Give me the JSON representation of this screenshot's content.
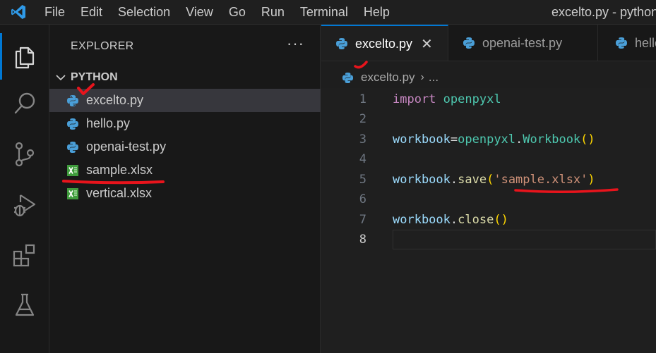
{
  "titlebar": {
    "menu": [
      "File",
      "Edit",
      "Selection",
      "View",
      "Go",
      "Run",
      "Terminal",
      "Help"
    ],
    "window_title": "excelto.py - python"
  },
  "activity_bar": {
    "icons": [
      "explorer-icon",
      "search-icon",
      "source-control-icon",
      "run-debug-icon",
      "extensions-icon",
      "testing-icon"
    ],
    "active": "explorer-icon",
    "accent": "#0078d4"
  },
  "sidebar": {
    "title": "EXPLORER",
    "more": "···",
    "folder": "PYTHON",
    "files": [
      {
        "name": "excelto.py",
        "icon": "python-file-icon",
        "selected": true
      },
      {
        "name": "hello.py",
        "icon": "python-file-icon",
        "selected": false
      },
      {
        "name": "openai-test.py",
        "icon": "python-file-icon",
        "selected": false
      },
      {
        "name": "sample.xlsx",
        "icon": "excel-file-icon",
        "selected": false
      },
      {
        "name": "vertical.xlsx",
        "icon": "excel-file-icon",
        "selected": false
      }
    ]
  },
  "tabs": [
    {
      "label": "excelto.py",
      "active": true,
      "close": "✕"
    },
    {
      "label": "openai-test.py",
      "active": false
    },
    {
      "label": "hello.py",
      "active": false
    }
  ],
  "breadcrumb": {
    "file": "excelto.py",
    "separator": "›",
    "more": "..."
  },
  "editor": {
    "current_line": 8,
    "line_numbers": [
      "1",
      "2",
      "3",
      "4",
      "5",
      "6",
      "7",
      "8"
    ],
    "lines": {
      "l1_kw": "import",
      "l1_mod": "openpyxl",
      "l3_var": "workbook",
      "l3_op": "=",
      "l3_mod": "openpyxl",
      "l3_dot": ".",
      "l3_cls": "Workbook",
      "l3_paren": "()",
      "l5_var": "workbook",
      "l5_dot": ".",
      "l5_fn": "save",
      "l5_open": "(",
      "l5_str": "'sample.xlsx'",
      "l5_close": ")",
      "l7_var": "workbook",
      "l7_dot": ".",
      "l7_fn": "close",
      "l7_paren": "()"
    }
  },
  "colors": {
    "keyword": "#c586c0",
    "module": "#4ec9b0",
    "variable": "#9cdcfe",
    "function": "#dcdcaa",
    "string": "#ce9178",
    "bracket": "#ffd700",
    "annotation": "#e8141c"
  }
}
